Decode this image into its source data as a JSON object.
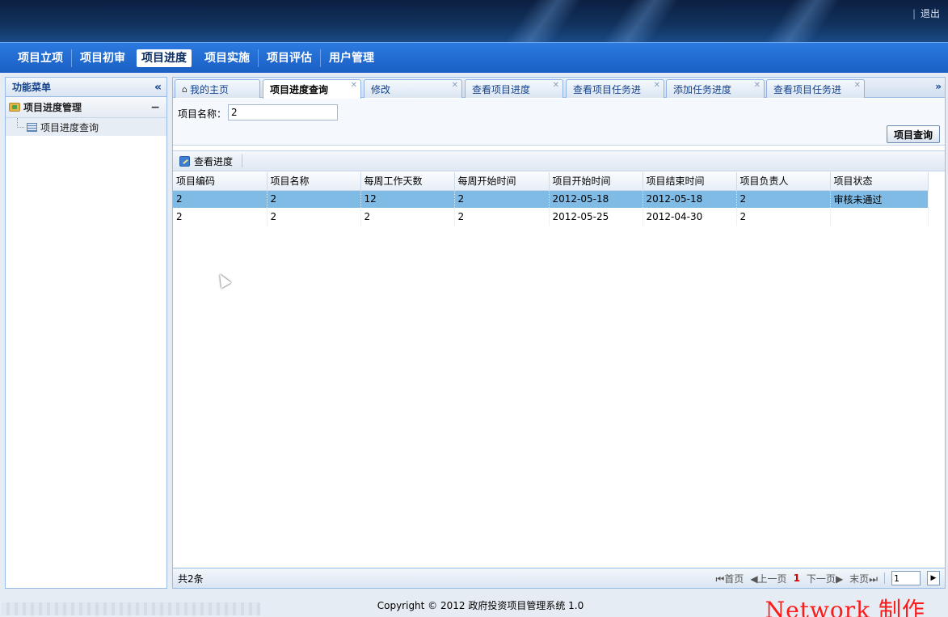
{
  "header": {
    "logout": "退出",
    "logout_sep": "|"
  },
  "nav": {
    "items": [
      {
        "label": "项目立项"
      },
      {
        "label": "项目初审"
      },
      {
        "label": "项目进度"
      },
      {
        "label": "项目实施"
      },
      {
        "label": "项目评估"
      },
      {
        "label": "用户管理"
      }
    ],
    "active_index": 2
  },
  "sidebar": {
    "title": "功能菜单",
    "collapse": "«",
    "group": {
      "label": "项目进度管理",
      "toggle": "−"
    },
    "items": [
      {
        "label": "项目进度查询"
      }
    ]
  },
  "tabs": [
    {
      "label": "我的主页",
      "closable": false
    },
    {
      "label": "项目进度查询",
      "closable": true,
      "active": true
    },
    {
      "label": "修改",
      "closable": true
    },
    {
      "label": "查看项目进度",
      "closable": true
    },
    {
      "label": "查看项目任务进",
      "closable": true
    },
    {
      "label": "添加任务进度",
      "closable": true
    },
    {
      "label": "查看项目任务进",
      "closable": true
    }
  ],
  "tab_scroll": "»",
  "search": {
    "label": "项目名称：",
    "value": "2",
    "button": "项目查询"
  },
  "toolbar": {
    "view_progress": "查看进度"
  },
  "table": {
    "columns": [
      "项目编码",
      "项目名称",
      "每周工作天数",
      "每周开始时间",
      "项目开始时间",
      "项目结束时间",
      "项目负责人",
      "项目状态"
    ],
    "rows": [
      [
        "2",
        "2",
        "12",
        "2",
        "2012-05-18",
        "2012-05-18",
        "2",
        "审核未通过"
      ],
      [
        "2",
        "2",
        "2",
        "2",
        "2012-05-25",
        "2012-04-30",
        "2",
        ""
      ]
    ],
    "selected_row": 0
  },
  "footer": {
    "total": "共2条",
    "first": "首页",
    "prev": "上一页",
    "current": "1",
    "next": "下一页",
    "last": "末页",
    "page_input": "1"
  },
  "copyright": "Copyright © 2012 政府投资项目管理系统 1.0",
  "watermark": "Network 制作"
}
